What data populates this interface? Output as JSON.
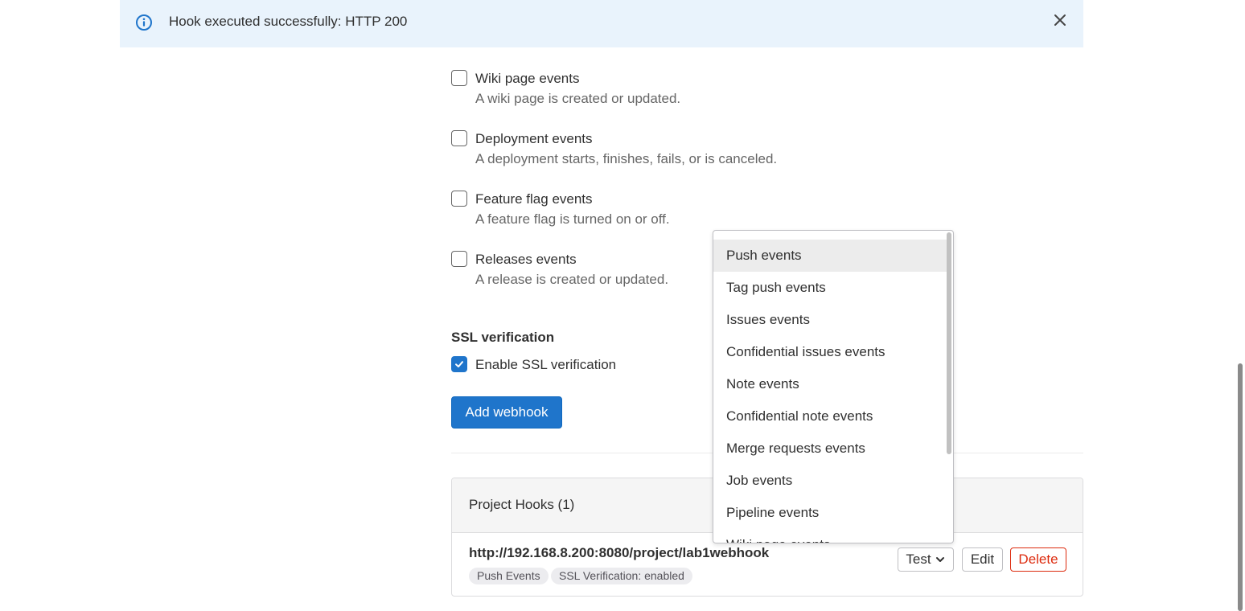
{
  "alert": {
    "message": "Hook executed successfully: HTTP 200"
  },
  "events": [
    {
      "label": "Wiki page events",
      "description": "A wiki page is created or updated.",
      "checked": false
    },
    {
      "label": "Deployment events",
      "description": "A deployment starts, finishes, fails, or is canceled.",
      "checked": false
    },
    {
      "label": "Feature flag events",
      "description": "A feature flag is turned on or off.",
      "checked": false
    },
    {
      "label": "Releases events",
      "description": "A release is created or updated.",
      "checked": false
    }
  ],
  "ssl": {
    "title": "SSL verification",
    "checkbox_label": "Enable SSL verification",
    "checked": true
  },
  "add_webhook_label": "Add webhook",
  "project_hooks": {
    "title": "Project Hooks (1)",
    "hook": {
      "url": "http://192.168.8.200:8080/project/lab1webhook",
      "badges": [
        "Push Events",
        "SSL Verification: enabled"
      ],
      "test_label": "Test",
      "edit_label": "Edit",
      "delete_label": "Delete"
    }
  },
  "test_dropdown": {
    "items": [
      "Push events",
      "Tag push events",
      "Issues events",
      "Confidential issues events",
      "Note events",
      "Confidential note events",
      "Merge requests events",
      "Job events",
      "Pipeline events",
      "Wiki page events"
    ],
    "highlighted": "Push events"
  },
  "colors": {
    "accent": "#1f75cb",
    "alert_bg": "#e9f3fc",
    "danger": "#dd2b0e"
  }
}
